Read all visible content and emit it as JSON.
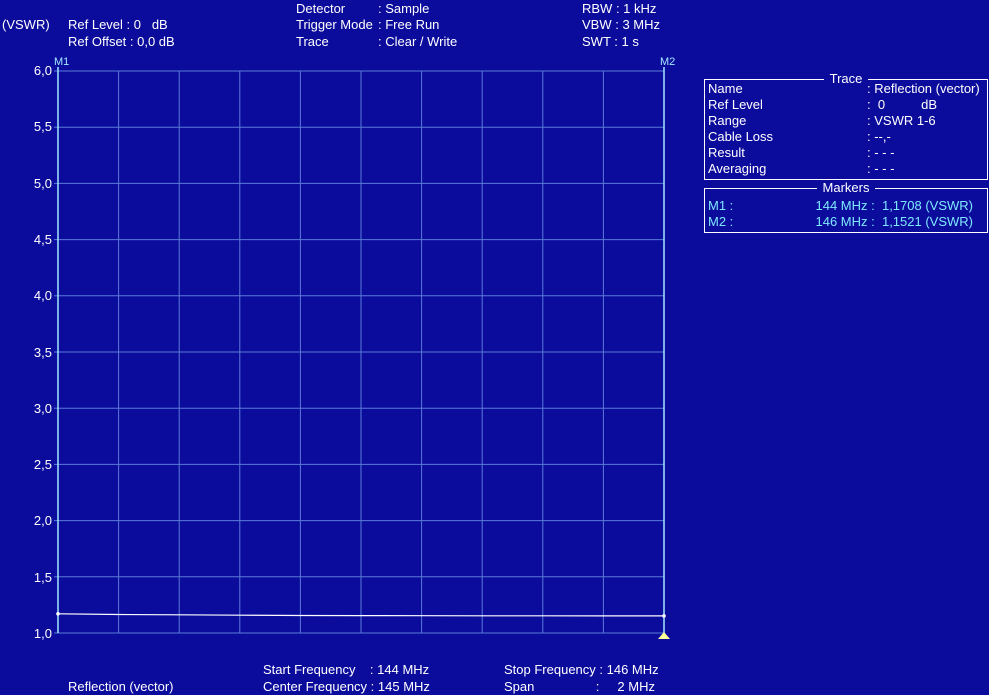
{
  "header": {
    "unit_label": "(VSWR)",
    "ref_level": "Ref Level : 0   dB",
    "ref_offset": "Ref Offset : 0,0 dB",
    "detector_key": "Detector",
    "detector_val": ": Sample",
    "trigger_key": "Trigger Mode",
    "trigger_val": ": Free Run",
    "trace_key": "Trace",
    "trace_val": ": Clear / Write",
    "rbw": "RBW : 1 kHz",
    "vbw": "VBW : 3 MHz",
    "swt": "SWT : 1 s"
  },
  "trace_panel": {
    "title": "Trace",
    "rows": [
      {
        "key": "Name",
        "value": ": Reflection (vector)"
      },
      {
        "key": "Ref Level",
        "value": ":  0          dB"
      },
      {
        "key": "Range",
        "value": ": VSWR 1-6"
      },
      {
        "key": "Cable Loss",
        "value": ": --,-"
      },
      {
        "key": "Result",
        "value": ": - - -"
      },
      {
        "key": "Averaging",
        "value": ": - - -"
      }
    ]
  },
  "markers_panel": {
    "title": "Markers",
    "rows": [
      {
        "key": "M1 :",
        "value": "144 MHz :  1,1708 (VSWR)"
      },
      {
        "key": "M2 :",
        "value": "146 MHz :  1,1521 (VSWR)"
      }
    ]
  },
  "footer": {
    "mode": "Reflection (vector)",
    "start_freq": "Start Frequency    : 144 MHz",
    "center_freq": "Center Frequency : 145 MHz",
    "stop_freq": "Stop Frequency : 146 MHz",
    "span": "Span                 :     2 MHz"
  },
  "colors": {
    "background": "#0c0c9c",
    "grid": "#5a7ad8",
    "trace": "#ffffff",
    "marker": "#a0e8ff",
    "marker_triangle": "#ffff99"
  },
  "chart_data": {
    "type": "line",
    "xlabel": "",
    "ylabel": "(VSWR)",
    "xlim": [
      144,
      146
    ],
    "ylim": [
      1.0,
      6.0
    ],
    "y_ticks": [
      "6,0",
      "5,5",
      "5,0",
      "4,5",
      "4,0",
      "3,5",
      "3,0",
      "2,5",
      "2,0",
      "1,5",
      "1,0"
    ],
    "grid": true,
    "markers": [
      {
        "name": "M1",
        "x": 144,
        "y": 1.1708
      },
      {
        "name": "M2",
        "x": 146,
        "y": 1.1521
      }
    ],
    "series": [
      {
        "name": "Reflection (vector)",
        "x": [
          144.0,
          144.2,
          144.4,
          144.6,
          144.8,
          145.0,
          145.2,
          145.4,
          145.6,
          145.8,
          146.0
        ],
        "values": [
          1.171,
          1.165,
          1.162,
          1.158,
          1.156,
          1.155,
          1.154,
          1.153,
          1.153,
          1.152,
          1.152
        ]
      }
    ]
  }
}
